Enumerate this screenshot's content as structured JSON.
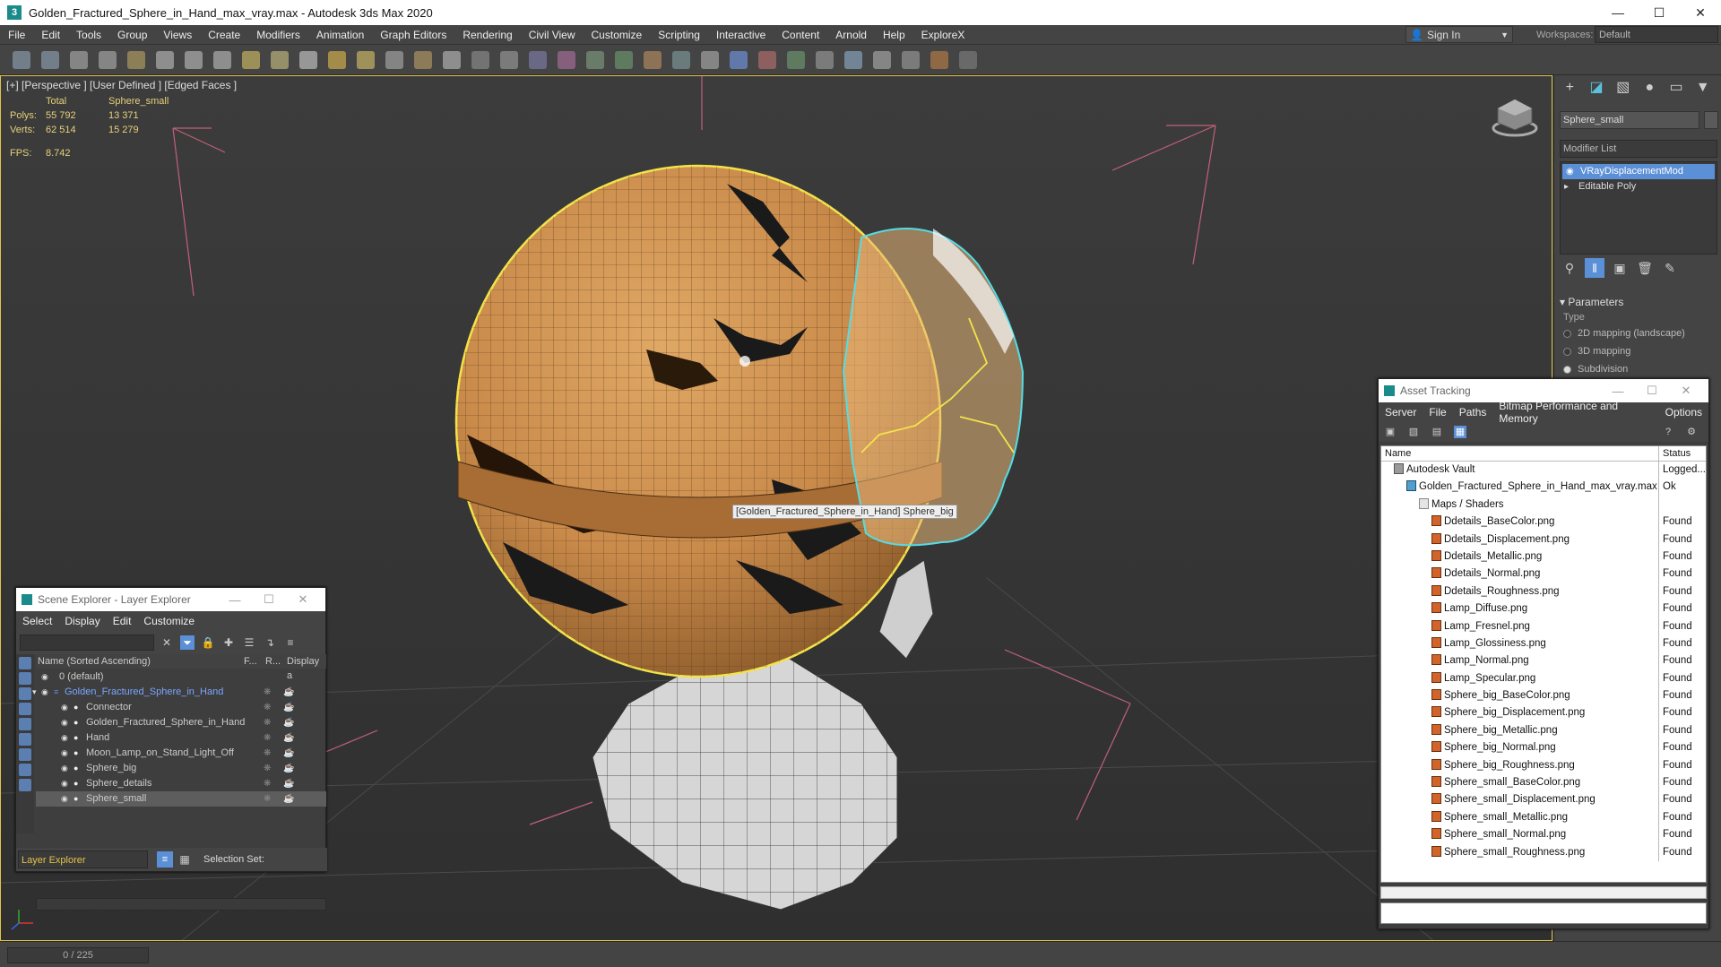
{
  "window": {
    "title": "Golden_Fractured_Sphere_in_Hand_max_vray.max - Autodesk 3ds Max 2020",
    "app_icon": "3"
  },
  "menu": {
    "items": [
      "File",
      "Edit",
      "Tools",
      "Group",
      "Views",
      "Create",
      "Modifiers",
      "Animation",
      "Graph Editors",
      "Rendering",
      "Civil View",
      "Customize",
      "Scripting",
      "Interactive",
      "Content",
      "Arnold",
      "Help",
      "ExploreX"
    ],
    "sign_in": "Sign In",
    "workspaces_label": "Workspaces:",
    "workspace_value": "Default"
  },
  "viewport": {
    "label": "[+] [Perspective ] [User Defined ] [Edged Faces ]",
    "stats": {
      "header_total": "Total",
      "header_obj": "Sphere_small",
      "polys_label": "Polys:",
      "polys_total": "55 792",
      "polys_obj": "13 371",
      "verts_label": "Verts:",
      "verts_total": "62 514",
      "verts_obj": "15 279",
      "fps_label": "FPS:",
      "fps_value": "8.742"
    },
    "tooltip": "[Golden_Fractured_Sphere_in_Hand] Sphere_big"
  },
  "command_panel": {
    "object_name": "Sphere_small",
    "modifier_list": "Modifier List",
    "stack": [
      "VRayDisplacementMod",
      "Editable Poly"
    ],
    "params_header": "Parameters",
    "type_label": "Type",
    "options": [
      "2D mapping (landscape)",
      "3D mapping",
      "Subdivision"
    ],
    "selected_option": 2
  },
  "scene_explorer": {
    "title": "Scene Explorer - Layer Explorer",
    "menu": [
      "Select",
      "Display",
      "Edit",
      "Customize"
    ],
    "columns": [
      "Name (Sorted Ascending)",
      "F...",
      "R...",
      "Display a"
    ],
    "rows": [
      {
        "name": "0 (default)",
        "level": 0
      },
      {
        "name": "Golden_Fractured_Sphere_in_Hand",
        "level": 0
      },
      {
        "name": "Connector",
        "level": 1
      },
      {
        "name": "Golden_Fractured_Sphere_in_Hand",
        "level": 1
      },
      {
        "name": "Hand",
        "level": 1
      },
      {
        "name": "Moon_Lamp_on_Stand_Light_Off",
        "level": 1
      },
      {
        "name": "Sphere_big",
        "level": 1
      },
      {
        "name": "Sphere_details",
        "level": 1
      },
      {
        "name": "Sphere_small",
        "level": 1
      }
    ],
    "bottom_label": "Layer Explorer",
    "selection_set": "Selection Set:"
  },
  "asset_tracking": {
    "title": "Asset Tracking",
    "menu": [
      "Server",
      "File",
      "Paths",
      "Bitmap Performance and Memory",
      "Options"
    ],
    "columns": [
      "Name",
      "Status"
    ],
    "rows": [
      {
        "name": "Autodesk Vault",
        "status": "Logged...",
        "indent": 14,
        "icon": "vault"
      },
      {
        "name": "Golden_Fractured_Sphere_in_Hand_max_vray.max",
        "status": "Ok",
        "indent": 28,
        "icon": "max"
      },
      {
        "name": "Maps / Shaders",
        "status": "",
        "indent": 42,
        "icon": "folder"
      },
      {
        "name": "Ddetails_BaseColor.png",
        "status": "Found",
        "indent": 56,
        "icon": "file"
      },
      {
        "name": "Ddetails_Displacement.png",
        "status": "Found",
        "indent": 56,
        "icon": "file"
      },
      {
        "name": "Ddetails_Metallic.png",
        "status": "Found",
        "indent": 56,
        "icon": "file"
      },
      {
        "name": "Ddetails_Normal.png",
        "status": "Found",
        "indent": 56,
        "icon": "file"
      },
      {
        "name": "Ddetails_Roughness.png",
        "status": "Found",
        "indent": 56,
        "icon": "file"
      },
      {
        "name": "Lamp_Diffuse.png",
        "status": "Found",
        "indent": 56,
        "icon": "file"
      },
      {
        "name": "Lamp_Fresnel.png",
        "status": "Found",
        "indent": 56,
        "icon": "file"
      },
      {
        "name": "Lamp_Glossiness.png",
        "status": "Found",
        "indent": 56,
        "icon": "file"
      },
      {
        "name": "Lamp_Normal.png",
        "status": "Found",
        "indent": 56,
        "icon": "file"
      },
      {
        "name": "Lamp_Specular.png",
        "status": "Found",
        "indent": 56,
        "icon": "file"
      },
      {
        "name": "Sphere_big_BaseColor.png",
        "status": "Found",
        "indent": 56,
        "icon": "file"
      },
      {
        "name": "Sphere_big_Displacement.png",
        "status": "Found",
        "indent": 56,
        "icon": "file"
      },
      {
        "name": "Sphere_big_Metallic.png",
        "status": "Found",
        "indent": 56,
        "icon": "file"
      },
      {
        "name": "Sphere_big_Normal.png",
        "status": "Found",
        "indent": 56,
        "icon": "file"
      },
      {
        "name": "Sphere_big_Roughness.png",
        "status": "Found",
        "indent": 56,
        "icon": "file"
      },
      {
        "name": "Sphere_small_BaseColor.png",
        "status": "Found",
        "indent": 56,
        "icon": "file"
      },
      {
        "name": "Sphere_small_Displacement.png",
        "status": "Found",
        "indent": 56,
        "icon": "file"
      },
      {
        "name": "Sphere_small_Metallic.png",
        "status": "Found",
        "indent": 56,
        "icon": "file"
      },
      {
        "name": "Sphere_small_Normal.png",
        "status": "Found",
        "indent": 56,
        "icon": "file"
      },
      {
        "name": "Sphere_small_Roughness.png",
        "status": "Found",
        "indent": 56,
        "icon": "file"
      }
    ]
  },
  "status": {
    "time_slider": "0 / 225"
  },
  "colors": {
    "selection_yellow": "#e1c24a",
    "accent_blue": "#5b8fd6",
    "sphere_gold": "#c98a4a"
  }
}
